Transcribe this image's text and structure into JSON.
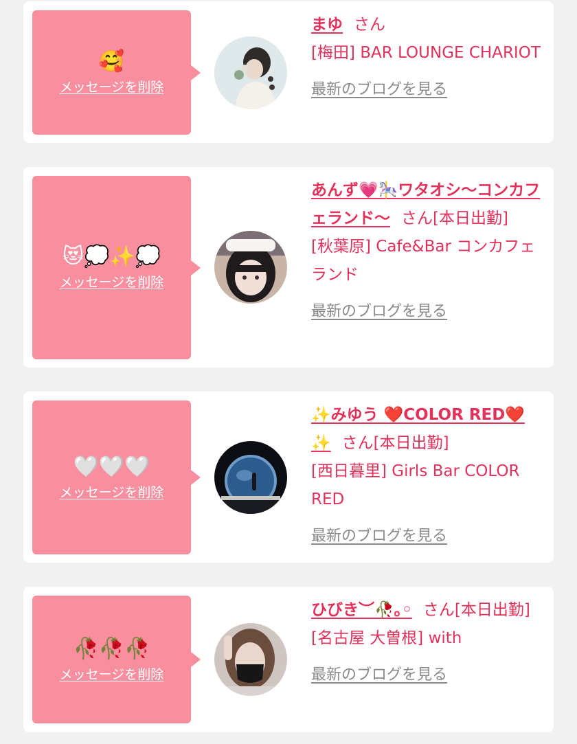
{
  "messages": [
    {
      "emoji": "🥰",
      "delete_label": "メッセージを削除",
      "name": "まゆ",
      "suffix": "さん",
      "shop": "[梅田] BAR LOUNGE CHARIOT",
      "blog_label": "最新のブログを見る"
    },
    {
      "emoji": "😻💭✨💭",
      "delete_label": "メッセージを削除",
      "name": "あんず💗🎠ワタオシ〜コンカフェランド〜",
      "suffix": "さん[本日出勤]",
      "shop": "[秋葉原] Cafe&Bar コンカフェランド",
      "blog_label": "最新のブログを見る"
    },
    {
      "emoji": "🤍🤍🤍",
      "delete_label": "メッセージを削除",
      "name": "✨みゆう ❤️COLOR RED❤️✨",
      "suffix": "さん[本日出勤]",
      "shop": "[西日暮里] Girls Bar COLOR RED",
      "blog_label": "最新のブログを見る"
    },
    {
      "emoji": "🥀🥀🥀",
      "delete_label": "メッセージを削除",
      "name": "ひびき︶🥀｡◦",
      "suffix": "さん[本日出勤]",
      "shop": "[名古屋 大曽根] with",
      "blog_label": "最新のブログを見る"
    }
  ],
  "colors": {
    "accent_pink": "#e0325a",
    "message_box": "#f98e9e",
    "link_gray": "#8a8a8a",
    "background": "#f1f1f1"
  }
}
